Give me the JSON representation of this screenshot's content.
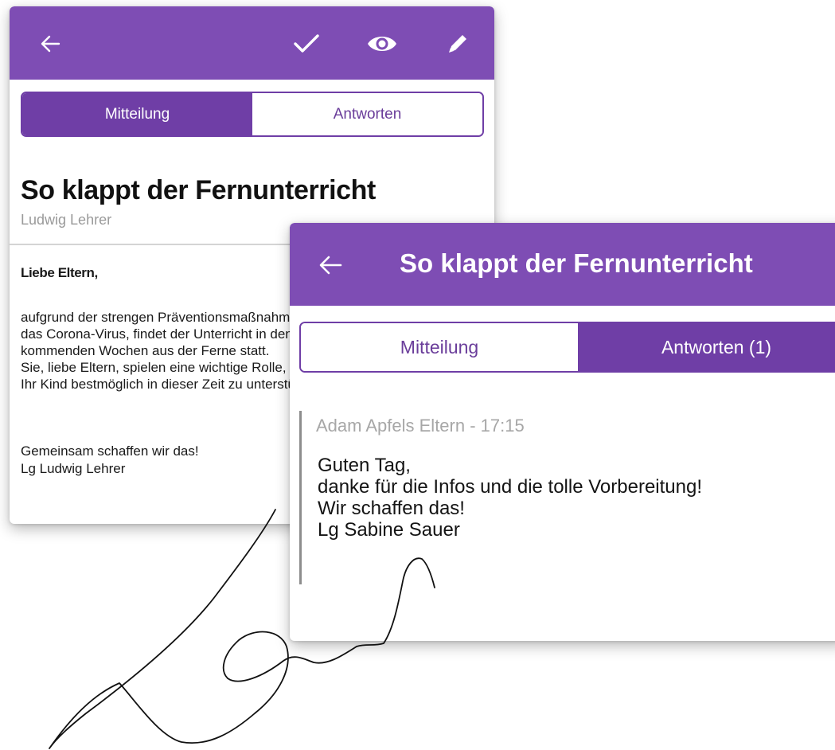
{
  "back_card": {
    "tabs": [
      {
        "label": "Mitteilung",
        "active": true
      },
      {
        "label": "Antworten",
        "active": false
      }
    ],
    "title": "So klappt der Fernunterricht",
    "author": "Ludwig Lehrer",
    "body": {
      "greeting": "Liebe Eltern,",
      "lines": [
        "aufgrund der strengen Präventionsmaßnahmen gegen",
        "das Corona-Virus, findet der Unterricht in den",
        "kommenden Wochen aus der Ferne statt.",
        "Sie, liebe Eltern, spielen eine wichtige Rolle, um",
        "Ihr Kind bestmöglich in dieser Zeit zu unterstützen."
      ],
      "closing": "Gemeinsam schaffen wir das!",
      "signoff": "Lg Ludwig Lehrer"
    },
    "icons": [
      "back-arrow-icon",
      "check-icon",
      "eye-icon",
      "pencil-icon"
    ]
  },
  "front_card": {
    "title": "So klappt der Fernunterricht",
    "tabs": [
      {
        "label": "Mitteilung",
        "active": false
      },
      {
        "label": "Antworten (1)",
        "active": true
      }
    ],
    "reply": {
      "meta": "Adam Apfels Eltern - 17:15",
      "lines": [
        "Guten Tag,",
        "danke für die Infos und die tolle Vorbereitung!",
        "Wir schaffen das!",
        "Lg Sabine Sauer"
      ]
    },
    "icons": [
      "back-arrow-icon"
    ]
  },
  "colors": {
    "appbar": "#7e4db4",
    "accent": "#6f3ea6"
  }
}
